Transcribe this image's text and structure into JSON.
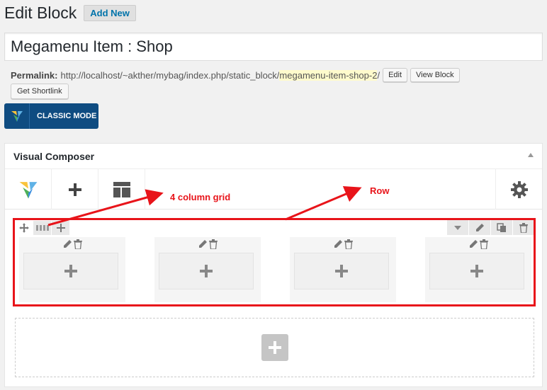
{
  "header": {
    "title": "Edit Block",
    "add_new": "Add New"
  },
  "post_title": "Megamenu Item : Shop",
  "permalink": {
    "label": "Permalink:",
    "base_url": "http://localhost/~akther/mybag/index.php/static_block/",
    "slug": "megamenu-item-shop-2",
    "trailing": "/",
    "edit_button": "Edit",
    "view_button": "View Block",
    "shortlink_button": "Get Shortlink"
  },
  "classic_mode": "CLASSIC MODE",
  "visual_composer": {
    "title": "Visual Composer"
  },
  "annotations": {
    "grid": "4 column grid",
    "row": "Row"
  },
  "colors": {
    "brand_blue": "#0f4c81",
    "annotation_red": "#e8141a"
  },
  "icons": [
    "vc-logo-icon",
    "add-element-icon",
    "templates-icon",
    "settings-gear-icon",
    "move-icon",
    "column-layout-icon",
    "add-column-icon",
    "toggle-caret-icon",
    "edit-pencil-icon",
    "clone-icon",
    "trash-icon"
  ]
}
